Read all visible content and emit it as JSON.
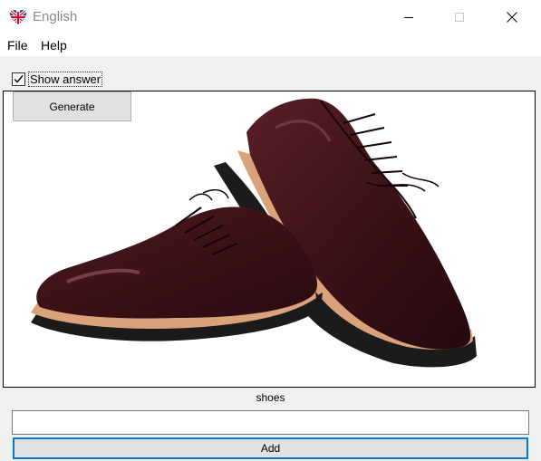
{
  "window": {
    "title": "English",
    "app_icon": "uk-flag-heart-icon",
    "controls": [
      "minimize-icon",
      "maximize-icon",
      "close-icon"
    ]
  },
  "menu": {
    "items": [
      {
        "label": "File"
      },
      {
        "label": "Help"
      }
    ]
  },
  "toolbar": {
    "show_answer": {
      "label": "Show answer",
      "checked": true
    },
    "generate_label": "Generate"
  },
  "card": {
    "image": "shoe-pair-illustration",
    "answer_text": "shoes"
  },
  "entry": {
    "value": "",
    "add_label": "Add"
  },
  "colors": {
    "client_bg": "#f0f0f0",
    "button_bg": "#e1e1e1",
    "focus_border": "#0078d7",
    "leather": "#3b1218",
    "sole": "#d9a27a"
  }
}
